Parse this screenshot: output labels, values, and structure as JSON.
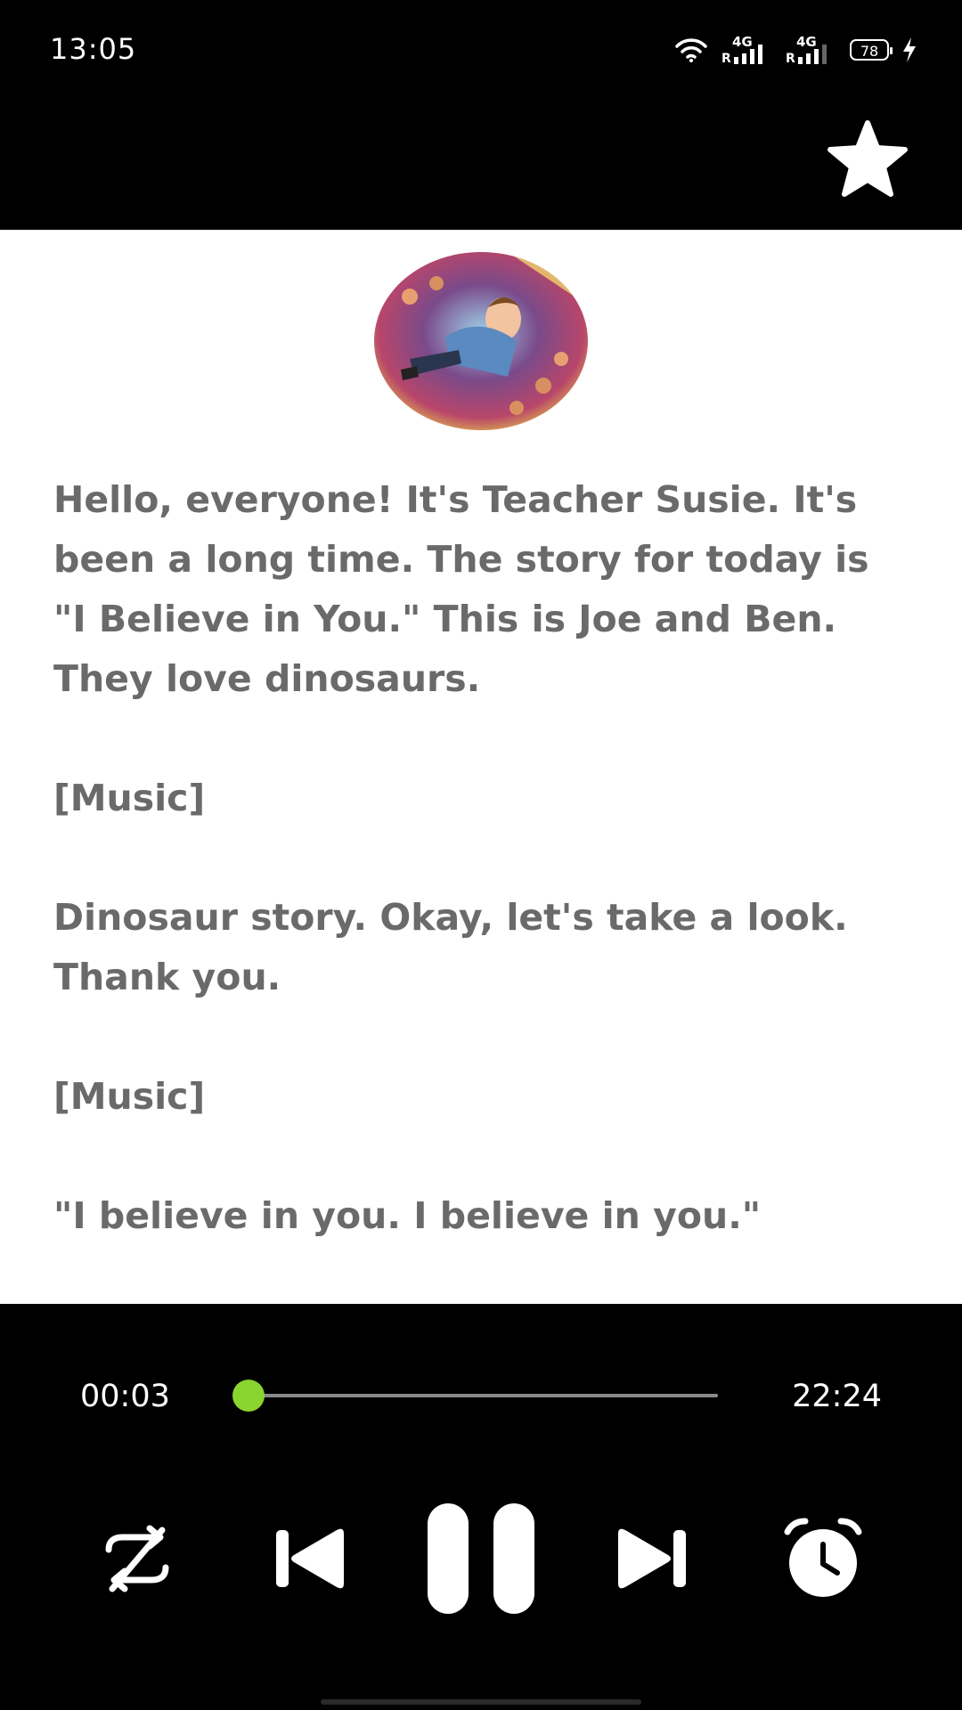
{
  "status_bar": {
    "time": "13:05",
    "network_1": "4G",
    "network_2": "4G",
    "roaming": "R",
    "battery": "78"
  },
  "header": {
    "favorite_icon": "star-icon"
  },
  "content": {
    "cover_icon": "story-cover-image",
    "paragraphs": [
      "Hello, everyone! It's Teacher Susie. It's been a long time. The story for today is \"I Believe in You.\" This is Joe and Ben. They love dinosaurs.",
      "[Music]",
      "Dinosaur story. Okay, let's take a look. Thank you.",
      "[Music]",
      "\"I believe in you. I believe in you.\""
    ]
  },
  "player": {
    "elapsed": "00:03",
    "duration": "22:24",
    "progress": 0.0022,
    "accent_color": "#8ad42f",
    "controls": [
      "shuffle-off-icon",
      "previous-icon",
      "pause-icon",
      "next-icon",
      "alarm-clock-icon"
    ]
  }
}
